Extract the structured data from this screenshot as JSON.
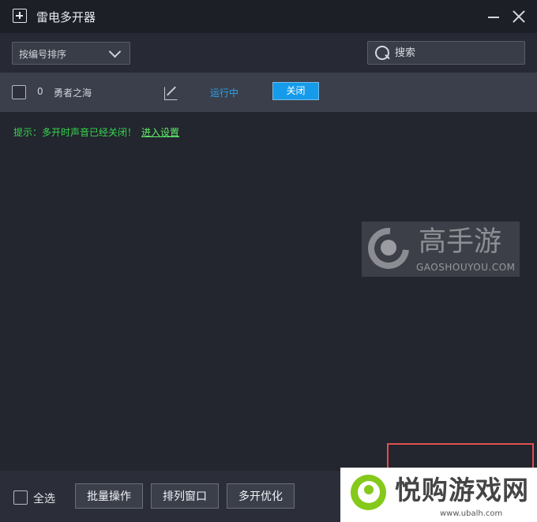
{
  "titlebar": {
    "title": "雷电多开器",
    "icons": {
      "app": "add-window-icon",
      "minimize": "minimize-icon",
      "close": "close-icon"
    }
  },
  "toolbar": {
    "sort": {
      "selected": "按编号排序",
      "icon": "chevron-down-icon"
    },
    "search": {
      "placeholder": "搜索",
      "value": "",
      "icon": "search-icon"
    }
  },
  "instances": [
    {
      "index": "0",
      "name": "勇者之海",
      "status": "运行中",
      "action": "关闭",
      "edit_icon": "edit-icon"
    }
  ],
  "hint": {
    "text": "提示：多开时声音已经关闭！",
    "link": "进入设置"
  },
  "footer": {
    "select_all": "全选",
    "buttons": [
      "批量操作",
      "排列窗口",
      "多开优化"
    ]
  },
  "watermarks": {
    "gaoshouyou": {
      "cn": "高手游",
      "en": "GAOSHOUYOU.COM"
    },
    "ubalh": {
      "cn": "悦购游戏网",
      "url": "www.ubalh.com"
    }
  },
  "colors": {
    "background": "#23252f",
    "accent": "#159bea",
    "status": "#2ea2e8",
    "hint": "#37d64c",
    "highlight": "#de5050"
  }
}
